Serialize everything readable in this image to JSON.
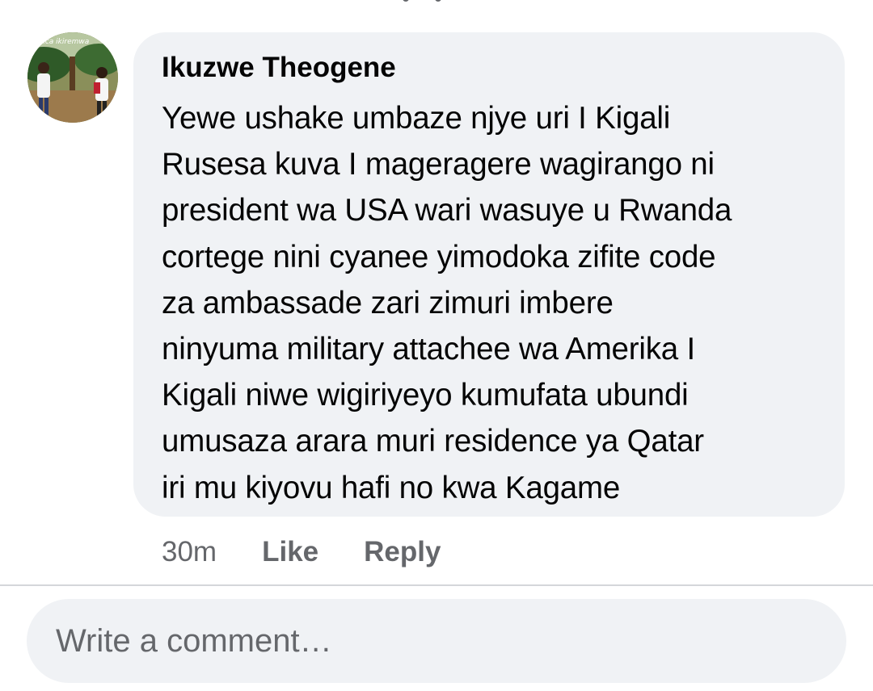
{
  "comment": {
    "author": "Ikuzwe Theogene",
    "text": "Yewe ushake umbaze njye uri I Kigali\nRusesa kuva I mageragere wagirango ni\npresident wa USA wari wasuye u Rwanda\ncortege nini cyanee yimodoka zifite code\nza ambassade zari zimuri imbere\nninyuma military attachee wa Amerika I\nKigali niwe wigiriyeyo kumufata ubundi\numusaza arara muri residence ya Qatar\niri mu kiyovu hafi no kwa Kagame",
    "avatar_caption": "vica ikiremwa",
    "timestamp": "30m",
    "like_label": "Like",
    "reply_label": "Reply"
  },
  "composer": {
    "placeholder": "Write a comment…"
  },
  "colors": {
    "bubble_bg": "#f0f2f5",
    "text_primary": "#050505",
    "text_secondary": "#65676b",
    "divider": "#d4d6da"
  }
}
